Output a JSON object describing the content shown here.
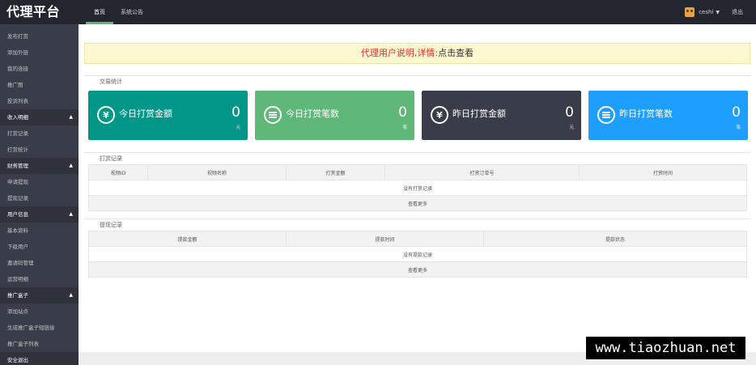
{
  "app": {
    "logo": "代理平台"
  },
  "topnav": {
    "items": [
      {
        "label": "首页",
        "active": true
      },
      {
        "label": "系统公告",
        "active": false
      }
    ],
    "user": "ceshi",
    "logout": "退出"
  },
  "sidebar": {
    "top_items": [
      "发布打赏",
      "添加外链",
      "我的连接",
      "推广图",
      "投诉列表"
    ],
    "groups": [
      {
        "title": "收入明细",
        "items": [
          "打赏记录",
          "打赏统计"
        ]
      },
      {
        "title": "财务管理",
        "items": [
          "申请提现",
          "提现记录"
        ]
      },
      {
        "title": "用户信息",
        "items": [
          "基本资料",
          "下级用户",
          "邀请码管理",
          "运营明细"
        ]
      },
      {
        "title": "推广盒子",
        "items": [
          "添加站点",
          "生成推广盒子短链接",
          "推广盒子列表"
        ]
      }
    ],
    "bottom_item": "安全退出"
  },
  "notice": {
    "red_text": "代理用户说明,详情:",
    "dark_text": "点击查看"
  },
  "sections": {
    "stats": "交易统计",
    "tips": "打赏记录",
    "withdraw": "提现记录"
  },
  "stats_cards": [
    {
      "label": "今日打赏金额",
      "value": "0",
      "unit": "元",
      "color": "#009688",
      "icon": "yen-icon"
    },
    {
      "label": "今日打赏笔数",
      "value": "0",
      "unit": "笔",
      "color": "#5fb878",
      "icon": "list-icon"
    },
    {
      "label": "昨日打赏金额",
      "value": "0",
      "unit": "元",
      "color": "#393d49",
      "icon": "yen-icon"
    },
    {
      "label": "昨日打赏笔数",
      "value": "0",
      "unit": "笔",
      "color": "#1e9fff",
      "icon": "list-icon"
    }
  ],
  "tips_table": {
    "headers": [
      "视频ID",
      "视频名称",
      "打赏金额",
      "打赏订单号",
      "打赏时间"
    ],
    "empty": "没有打赏记录",
    "more": "查看更多"
  },
  "withdraw_table": {
    "headers": [
      "提款金额",
      "提款时间",
      "提款状态"
    ],
    "empty": "没有提款记录",
    "more": "查看更多"
  },
  "watermark": "www.tiaozhuan.net"
}
